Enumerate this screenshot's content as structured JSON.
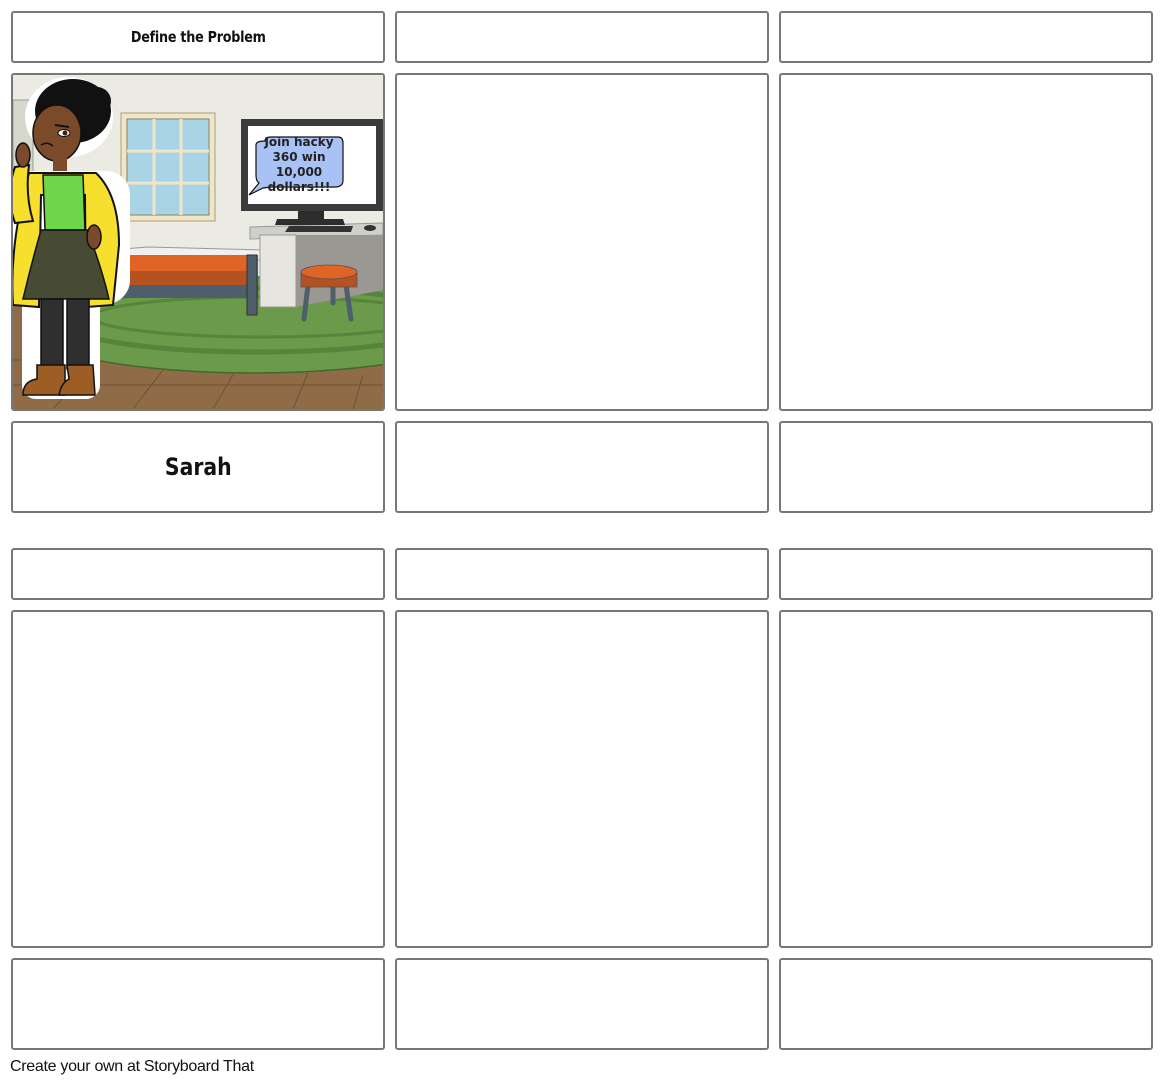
{
  "storyboard": {
    "columns": 3,
    "rows": [
      {
        "titles": [
          "Define the Problem",
          "",
          ""
        ],
        "scenes": [
          {
            "has_illustration": true,
            "background": "bedroom",
            "character": "Sarah",
            "speech_bubble": [
              "Join hacky",
              "360 win",
              "10,000",
              "dollars!!!"
            ]
          },
          {
            "has_illustration": false
          },
          {
            "has_illustration": false
          }
        ],
        "descriptions": [
          "Sarah",
          "",
          ""
        ]
      },
      {
        "titles": [
          "",
          "",
          ""
        ],
        "scenes": [
          {
            "has_illustration": false
          },
          {
            "has_illustration": false
          },
          {
            "has_illustration": false
          }
        ],
        "descriptions": [
          "",
          "",
          ""
        ]
      }
    ]
  },
  "colors": {
    "border": "#777777",
    "bubble_fill": "#a9c2f5",
    "wall": "#ebebe3",
    "rug": "#6a9a4a",
    "floor": "#8f6c47",
    "bed": "#e06425"
  },
  "footer": {
    "text": "Create your own at Storyboard That"
  }
}
